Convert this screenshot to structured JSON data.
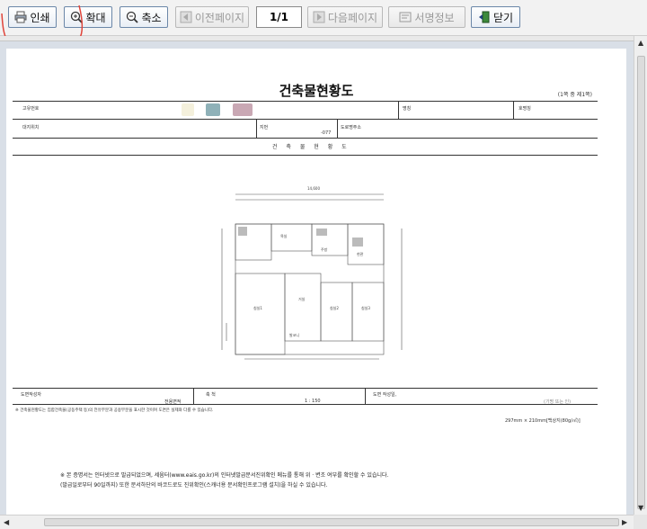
{
  "toolbar": {
    "print_label": "인쇄",
    "zoom_in_label": "확대",
    "zoom_out_label": "축소",
    "prev_label": "이전페이지",
    "page_indicator": "1/1",
    "next_label": "다음페이지",
    "signature_label": "서명정보",
    "close_label": "닫기"
  },
  "icons": {
    "print": "printer-icon",
    "zoom_in": "zoom-in-icon",
    "zoom_out": "zoom-out-icon",
    "prev": "arrow-left-icon",
    "next": "arrow-right-icon",
    "signature": "signature-icon",
    "close": "exit-door-icon"
  },
  "colors": {
    "button_border": "#6b87a8",
    "annotation_stroke": "#e0443a",
    "viewer_background": "#d9dfe7"
  },
  "document": {
    "title": "건축물현황도",
    "page_count": "(1쪽 중 제1쪽)",
    "header": {
      "unique_no_label": "고유번호",
      "name_label": "명칭",
      "ho_label": "호명칭",
      "location_label": "대지위치",
      "lot_label": "지번",
      "lot_value": "-077",
      "road_address_label": "도로명주소",
      "section_title": "건 축 물 현 황 도"
    },
    "plan": {
      "overall_dimension": "14,600",
      "rooms": [
        "침실1",
        "침실2",
        "침실3",
        "거실",
        "욕실",
        "주방",
        "발코니",
        "현관"
      ]
    },
    "footer": {
      "author_label": "도면작성자",
      "area_label": "전용면적",
      "scale_label": "축 척",
      "scale_value": "1 : 150",
      "date_label": "도면 작성일,",
      "seal_label": "(기명 또는 인)",
      "note": "※ 건축물현황도는 집합건축물(공동주택 등)의 전유부분과 공용부분을 표시한 것이며 도면은 실제와 다를 수 있습니다.",
      "paper_size": "297mm × 210mm[백상지(80g/㎡)]"
    },
    "notice_lines": [
      "※ 본 증명서는 인터넷으로 발급되었으며, 세움터(www.eais.go.kr)의 인터넷발급문서진위확인 메뉴를 통해 위 · 변조 여부를 확인할 수 있습니다.",
      "(발급일로부터 90일까지) 또한 문서하단의 바코드로도 진위확인(스캐너용 문서확인프로그램 설치)을 하실 수 있습니다."
    ]
  }
}
